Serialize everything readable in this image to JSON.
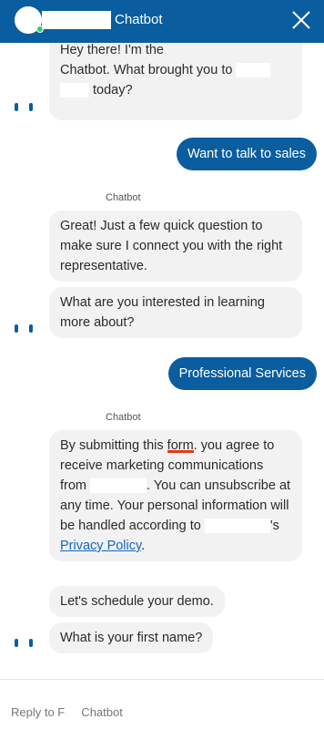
{
  "header": {
    "title": "Chatbot",
    "close_icon": "close-icon",
    "accent": "#0a5d9e",
    "status_color": "#37c871"
  },
  "messages": {
    "m1": {
      "line1": "Hey there! I'm the",
      "line2_a": "Chatbot. What brought you to ",
      "line3_b": " today?"
    },
    "user1": "Want to talk to sales",
    "sender1": "Chatbot",
    "m2": "Great! Just a few quick question to make sure I connect you with the right representative.",
    "m3": "What are you interested in learning more about?",
    "user2": "Professional Services",
    "sender2": "Chatbot",
    "m4": {
      "part1": "By submitting this ",
      "form_word": "form.",
      "part2": " you agree to receive marketing communications from ",
      "part3": ".  You can unsubscribe at any time.  Your personal information will be handled according to ",
      "part4": "'s ",
      "privacy_link": "Privacy Policy",
      "end": "."
    },
    "m5": "Let's schedule your demo.",
    "m6": "What is your first name?"
  },
  "composer": {
    "placeholder": "Reply to F     Chatbot"
  }
}
